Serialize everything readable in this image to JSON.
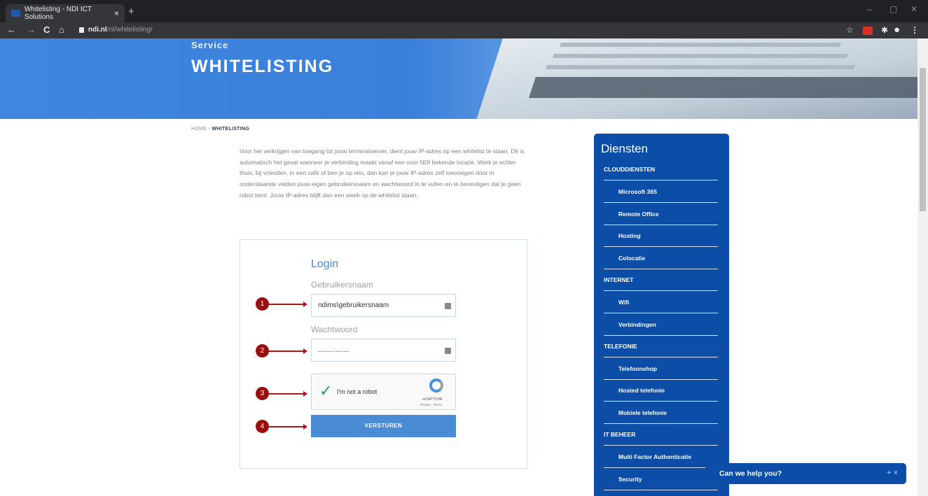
{
  "browser": {
    "tab_title": "Whitelisting - NDI ICT Solutions",
    "tab_close": "×",
    "new_tab": "+",
    "url_domain": "ndi.nl",
    "url_path": "/nl/whitelisting/",
    "nav": {
      "back": "←",
      "forward": "→",
      "reload": "C",
      "home": "⌂"
    },
    "window": {
      "minimize": "–",
      "restore": "▢",
      "close": "✕"
    },
    "ext_star": "☆",
    "ext_puzzle": "✱",
    "ext_menu": "⋮"
  },
  "hero": {
    "small": "Service",
    "big": "WHITELISTING"
  },
  "breadcrumb": {
    "home": "HOME",
    "separator": "›",
    "current": "WHITELISTING"
  },
  "intro": "Voor het verkrijgen van toegang tot jouw terminalserver, dient jouw IP-adres op een whitelist te staan. Dit is automatisch het geval wanneer je verbinding maakt vanaf een voor NDI bekende locatie. Werk je echter thuis, bij vrienden, in een café of ben je op reis, dan kan je jouw IP-adres zelf toevoegen door in onderstaande velden jouw eigen gebruikersnaam en wachtwoord in te vullen en te bevestigen dat je geen robot bent. Jouw IP-adres blijft dan een week op de whitelist staan.",
  "login": {
    "title": "Login",
    "username_label": "Gebruikersnaam",
    "username_value": "ndims\\gebruikersnaam",
    "password_label": "Wachtwoord",
    "password_value": "................",
    "captcha_check": "✓",
    "captcha_text": "I'm not a robot",
    "captcha_brand": "reCAPTCHA",
    "captcha_terms": "Privacy - Terms",
    "submit": "VERSTUREN"
  },
  "markers": [
    "1",
    "2",
    "3",
    "4"
  ],
  "sidebar": {
    "title": "Diensten",
    "sections": [
      {
        "label": "CLOUDDIENSTEN",
        "items": [
          "Microsoft 365",
          "Remote Office",
          "Hosting",
          "Colocatie"
        ]
      },
      {
        "label": "INTERNET",
        "items": [
          "Wifi",
          "Verbindingen"
        ]
      },
      {
        "label": "TELEFONIE",
        "items": [
          "Telefoonshop",
          "Hosted telefonie",
          "Mobiele telefonie"
        ]
      },
      {
        "label": "IT BEHEER",
        "items": [
          "Multi Factor Authenticatie",
          "Security"
        ]
      }
    ]
  },
  "chat": {
    "label": "Can we help you?",
    "controls": "+ ×"
  },
  "colors": {
    "brand_blue": "#0b4da7",
    "button_blue": "#4a8bd5",
    "marker_red": "#9a0e0e"
  }
}
